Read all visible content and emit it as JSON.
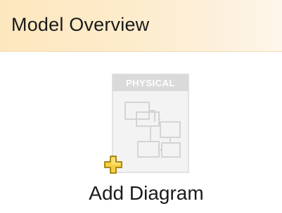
{
  "header": {
    "title": "Model Overview"
  },
  "add_diagram": {
    "label": "Add Diagram",
    "badge": "PHYSICAL",
    "icon": "physical-diagram-icon",
    "plus_icon": "add-plus-icon"
  },
  "colors": {
    "header_bg": "#fde7bf",
    "plus_fill": "#f7cf43",
    "doc_bg": "#f2f2f2",
    "badge_bg": "#d9d9d9"
  }
}
